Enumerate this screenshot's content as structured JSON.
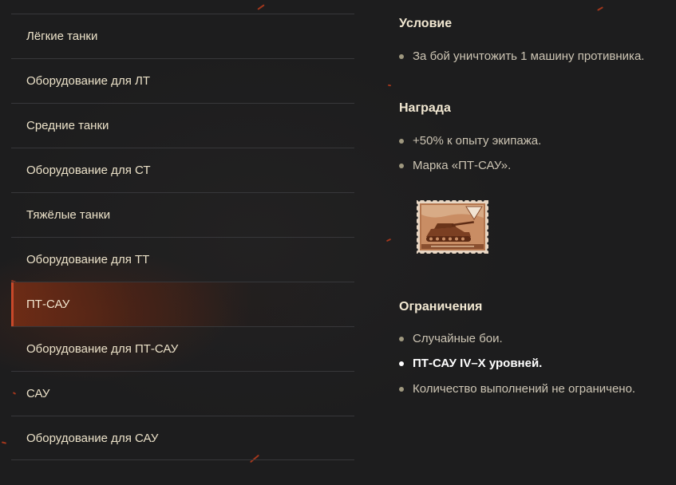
{
  "sidebar": {
    "items": [
      {
        "label": "Лёгкие танки",
        "active": false
      },
      {
        "label": "Оборудование для ЛТ",
        "active": false
      },
      {
        "label": "Средние танки",
        "active": false
      },
      {
        "label": "Оборудование для СТ",
        "active": false
      },
      {
        "label": "Тяжёлые танки",
        "active": false
      },
      {
        "label": "Оборудование для ТТ",
        "active": false
      },
      {
        "label": "ПТ-САУ",
        "active": true
      },
      {
        "label": "Оборудование для ПТ-САУ",
        "active": false
      },
      {
        "label": "САУ",
        "active": false
      },
      {
        "label": "Оборудование для САУ",
        "active": false
      }
    ]
  },
  "condition": {
    "title": "Условие",
    "items": [
      "За бой уничтожить 1 машину противника."
    ]
  },
  "reward": {
    "title": "Награда",
    "items": [
      "+50% к опыту экипажа.",
      "Марка «ПТ-САУ»."
    ]
  },
  "restrictions": {
    "title": "Ограничения",
    "items": [
      "Случайные бои.",
      "ПТ-САУ IV–X уровней.",
      "Количество выполнений не ограничено."
    ]
  },
  "colors": {
    "accent": "#c8482a",
    "background": "#1d1d1e",
    "text": "#ece2c9"
  },
  "icons": {
    "reward_stamp": "tank-destroyer-stamp-icon"
  }
}
